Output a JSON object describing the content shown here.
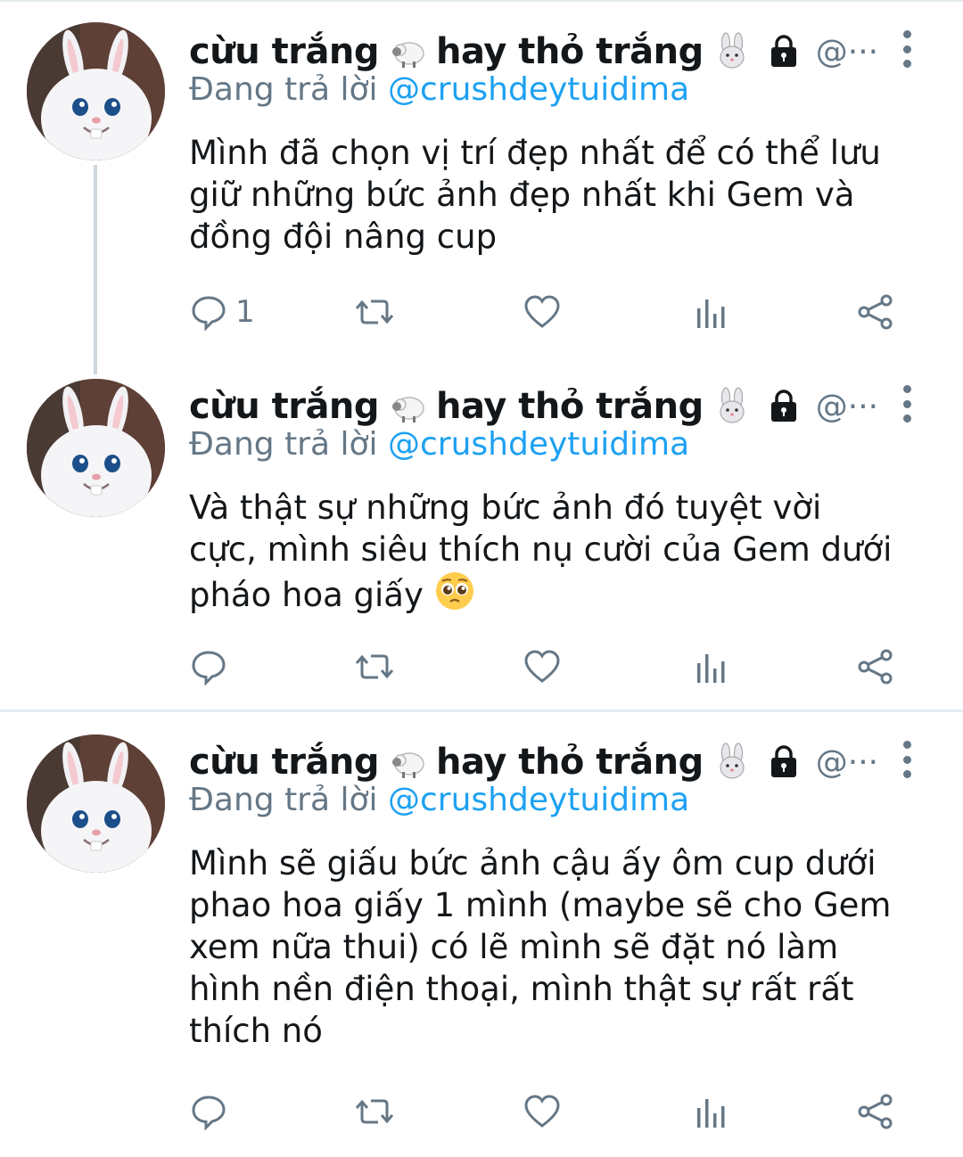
{
  "tweets": [
    {
      "display_name_a": "cừu trắng",
      "display_name_b": "hay thỏ trắng",
      "handle": "@···",
      "reply_prefix": "Đang trả lời",
      "reply_to": "@crushdeytuidima",
      "lines": [
        "Mình đã chọn vị trí đẹp nhất để có thể lưu",
        "giữ những bức ảnh đẹp nhất khi Gem và",
        "đồng đội nâng cup"
      ],
      "reply_count": "1"
    },
    {
      "display_name_a": "cừu trắng",
      "display_name_b": "hay thỏ trắng",
      "handle": "@···",
      "reply_prefix": "Đang trả lời",
      "reply_to": "@crushdeytuidima",
      "lines": [
        "Và thật sự những bức ảnh đó tuyệt vời",
        "cực, mình siêu thích nụ cười của Gem dưới",
        "pháo hoa giấy"
      ],
      "reply_count": ""
    },
    {
      "display_name_a": "cừu trắng",
      "display_name_b": "hay thỏ trắng",
      "handle": "@···",
      "reply_prefix": "Đang trả lời",
      "reply_to": "@crushdeytuidima",
      "lines": [
        "Mình sẽ giấu bức ảnh cậu ấy ôm cup dưới",
        "phao hoa giấy 1 mình (maybe sẽ cho Gem",
        "xem nữa thui) có lẽ mình sẽ đặt nó làm",
        "hình nền điện thoại, mình thật sự rất rất",
        "thích nó"
      ],
      "reply_count": ""
    }
  ],
  "icons": {
    "reply": "comment-bubble-icon",
    "retweet": "retweet-icon",
    "like": "heart-icon",
    "analytics": "analytics-bars-icon",
    "share": "share-icon",
    "name_emoji_1": "sheep-icon",
    "name_emoji_2": "rabbit-face-icon",
    "protected": "lock-icon",
    "more": "more-vertical-icon",
    "face": "pleading-face-emoji"
  },
  "colors": {
    "text": "#14171a",
    "muted": "#657786",
    "link": "#1da1f2",
    "divider": "#e6ecf0"
  }
}
